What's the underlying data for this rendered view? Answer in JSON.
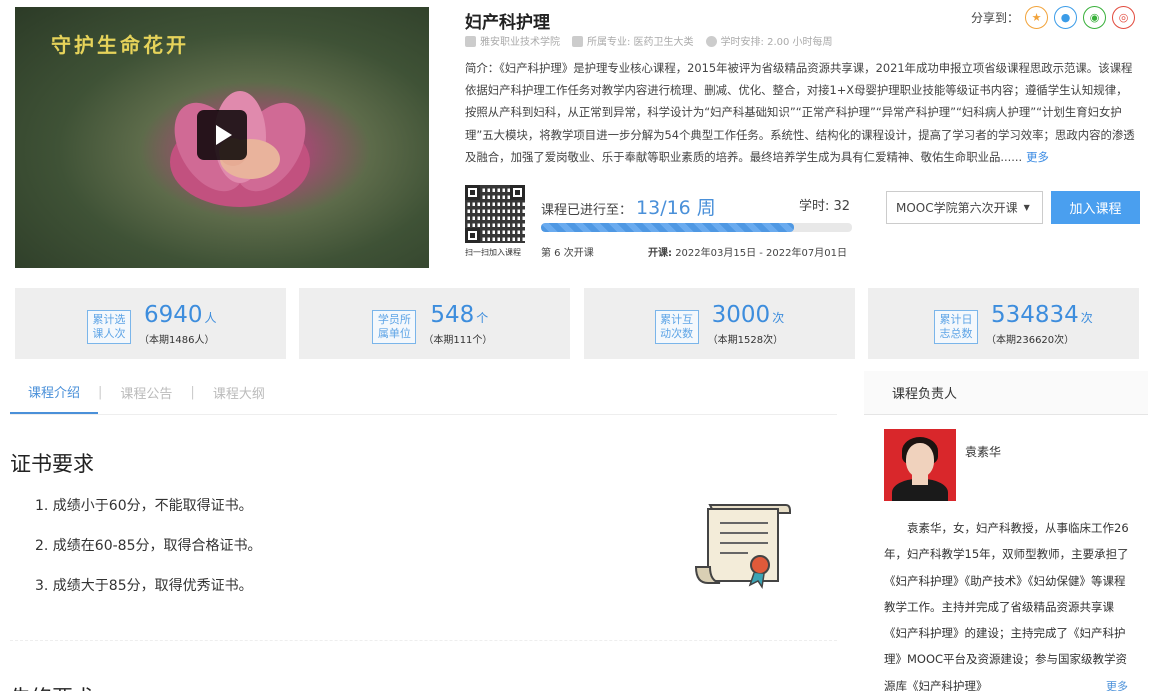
{
  "video": {
    "poster_title": "守护生命花开"
  },
  "course": {
    "title": "妇产科护理",
    "school": "雅安职业技术学院",
    "major": "所属专业: 医药卫生大类",
    "schedule": "学时安排: 2.00 小时每周",
    "intro": "简介：《妇产科护理》是护理专业核心课程，2015年被评为省级精品资源共享课，2021年成功申报立项省级课程思政示范课。该课程依据妇产科护理工作任务对教学内容进行梳理、删减、优化、整合，对接1+X母婴护理职业技能等级证书内容；遵循学生认知规律，按照从产科到妇科，从正常到异常，科学设计为“妇产科基础知识”“正常产科护理”“异常产科护理”“妇科病人护理”“计划生育妇女护理”五大模块，将教学项目进一步分解为54个典型工作任务。系统性、结构化的课程设计，提高了学习者的学习效率；思政内容的渗透及融合，加强了爱岗敬业、乐于奉献等职业素质的培养。最终培养学生成为具有仁爱精神、敬佑生命职业品......",
    "more": "更多"
  },
  "share": {
    "label": "分享到：",
    "icons": [
      "star-icon",
      "bell-icon",
      "wechat-icon",
      "weibo-icon"
    ]
  },
  "qr": {
    "label": "扫一扫加入课程"
  },
  "progress": {
    "label": "课程已进行至：",
    "value": "13/16 周",
    "fraction": 0.8125,
    "hours": "学时: 32",
    "session": "第 6 次开课",
    "dates_label": "开课:",
    "dates": "2022年03月15日 - 2022年07月01日"
  },
  "actions": {
    "select_value": "MOOC学院第六次开课",
    "join": "加入课程"
  },
  "stats": [
    {
      "badge": "累计选\n课人次",
      "value": "6940",
      "unit": "人",
      "sub": "（本期1486人）"
    },
    {
      "badge": "学员所\n属单位",
      "value": "548",
      "unit": "个",
      "sub": "（本期111个）"
    },
    {
      "badge": "累计互\n动次数",
      "value": "3000",
      "unit": "次",
      "sub": "（本期1528次）"
    },
    {
      "badge": "累计日\n志总数",
      "value": "534834",
      "unit": "次",
      "sub": "（本期236620次）"
    }
  ],
  "tabs": [
    "课程介绍",
    "课程公告",
    "课程大纲"
  ],
  "certificate": {
    "heading": "证书要求",
    "items": [
      "1. 成绩小于60分，不能取得证书。",
      "2. 成绩在60-85分，取得合格证书。",
      "3. 成绩大于85分，取得优秀证书。"
    ],
    "next_heading": "先修要求"
  },
  "teacher": {
    "panel_title": "课程负责人",
    "name": "袁素华",
    "bio": "袁素华，女，妇产科教授，从事临床工作26年，妇产科教学15年，双师型教师，主要承担了《妇产科护理》《助产技术》《妇幼保健》等课程教学工作。主持并完成了省级精品资源共享课《妇产科护理》的建设；主持完成了《妇产科护理》MOOC平台及资源建设；参与国家级教学资源库《妇产科护理》",
    "more": "更多"
  },
  "colors": {
    "accent": "#4a90d9",
    "button": "#4a9fef",
    "avatar_bg": "#d9272b"
  }
}
